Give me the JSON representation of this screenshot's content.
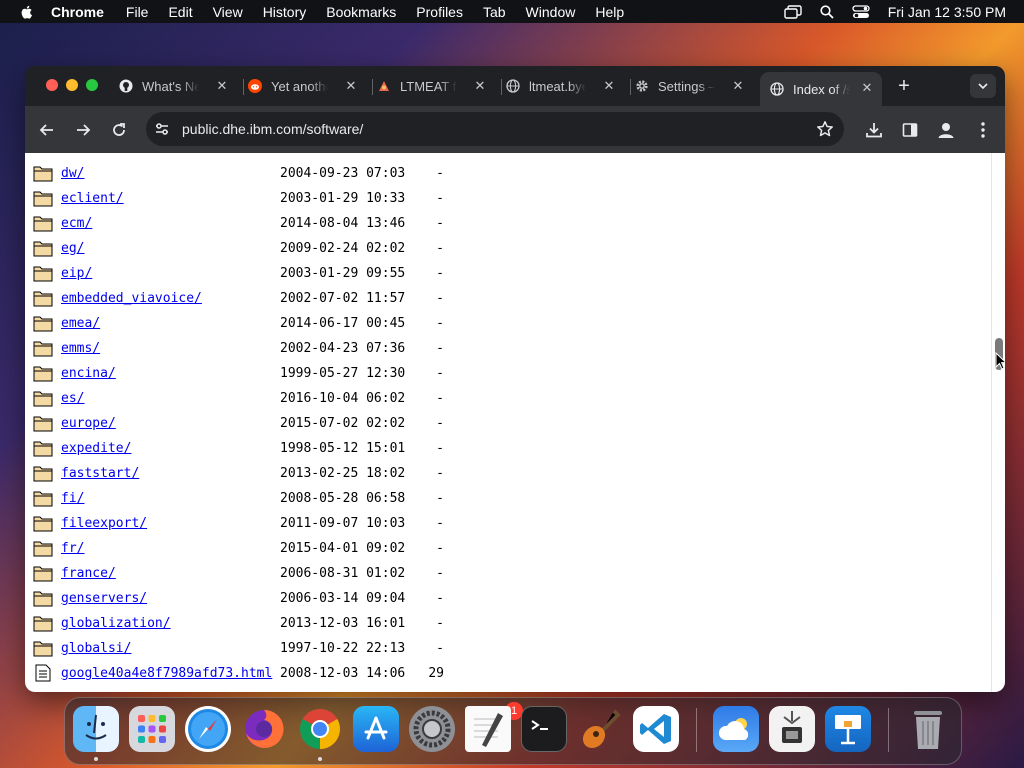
{
  "menubar": {
    "app": "Chrome",
    "items": [
      "File",
      "Edit",
      "View",
      "History",
      "Bookmarks",
      "Profiles",
      "Tab",
      "Window",
      "Help"
    ],
    "clock": "Fri Jan 12  3:50 PM"
  },
  "tabs": [
    {
      "title": "What's New",
      "icon": "github-icon"
    },
    {
      "title": "Yet another",
      "icon": "reddit-icon"
    },
    {
      "title": "LTMEAT fo",
      "icon": "ltmeat-icon"
    },
    {
      "title": "ltmeat.bye",
      "icon": "globe-icon"
    },
    {
      "title": "Settings – ",
      "icon": "gear-icon"
    },
    {
      "title": "Index of /s",
      "icon": "globe-icon",
      "active": true
    }
  ],
  "toolbar": {
    "url": "public.dhe.ibm.com/software/"
  },
  "listing": [
    {
      "name": "dw/",
      "date": "2004-09-23 07:03",
      "size": "-",
      "type": "folder"
    },
    {
      "name": "eclient/",
      "date": "2003-01-29 10:33",
      "size": "-",
      "type": "folder"
    },
    {
      "name": "ecm/",
      "date": "2014-08-04 13:46",
      "size": "-",
      "type": "folder"
    },
    {
      "name": "eg/",
      "date": "2009-02-24 02:02",
      "size": "-",
      "type": "folder"
    },
    {
      "name": "eip/",
      "date": "2003-01-29 09:55",
      "size": "-",
      "type": "folder"
    },
    {
      "name": "embedded_viavoice/",
      "date": "2002-07-02 11:57",
      "size": "-",
      "type": "folder"
    },
    {
      "name": "emea/",
      "date": "2014-06-17 00:45",
      "size": "-",
      "type": "folder"
    },
    {
      "name": "emms/",
      "date": "2002-04-23 07:36",
      "size": "-",
      "type": "folder"
    },
    {
      "name": "encina/",
      "date": "1999-05-27 12:30",
      "size": "-",
      "type": "folder"
    },
    {
      "name": "es/",
      "date": "2016-10-04 06:02",
      "size": "-",
      "type": "folder"
    },
    {
      "name": "europe/",
      "date": "2015-07-02 02:02",
      "size": "-",
      "type": "folder"
    },
    {
      "name": "expedite/",
      "date": "1998-05-12 15:01",
      "size": "-",
      "type": "folder"
    },
    {
      "name": "faststart/",
      "date": "2013-02-25 18:02",
      "size": "-",
      "type": "folder"
    },
    {
      "name": "fi/",
      "date": "2008-05-28 06:58",
      "size": "-",
      "type": "folder"
    },
    {
      "name": "fileexport/",
      "date": "2011-09-07 10:03",
      "size": "-",
      "type": "folder"
    },
    {
      "name": "fr/",
      "date": "2015-04-01 09:02",
      "size": "-",
      "type": "folder"
    },
    {
      "name": "france/",
      "date": "2006-08-31 01:02",
      "size": "-",
      "type": "folder"
    },
    {
      "name": "genservers/",
      "date": "2006-03-14 09:04",
      "size": "-",
      "type": "folder"
    },
    {
      "name": "globalization/",
      "date": "2013-12-03 16:01",
      "size": "-",
      "type": "folder"
    },
    {
      "name": "globalsi/",
      "date": "1997-10-22 22:13",
      "size": "-",
      "type": "folder"
    },
    {
      "name": "google40a4e8f7989afd73.html",
      "date": "2008-12-03 14:06",
      "size": "29",
      "type": "file"
    }
  ],
  "dock": {
    "apps": [
      "finder",
      "launchpad",
      "safari",
      "firefox",
      "chrome",
      "app-store",
      "system-settings",
      "textedit",
      "terminal",
      "garageband",
      "vscode",
      "weather",
      "system-information",
      "keynote",
      "trash"
    ],
    "settings_badge": "1"
  },
  "colors": {
    "link": "#0000ee",
    "tab_active": "#35363a",
    "window": "#202124"
  }
}
